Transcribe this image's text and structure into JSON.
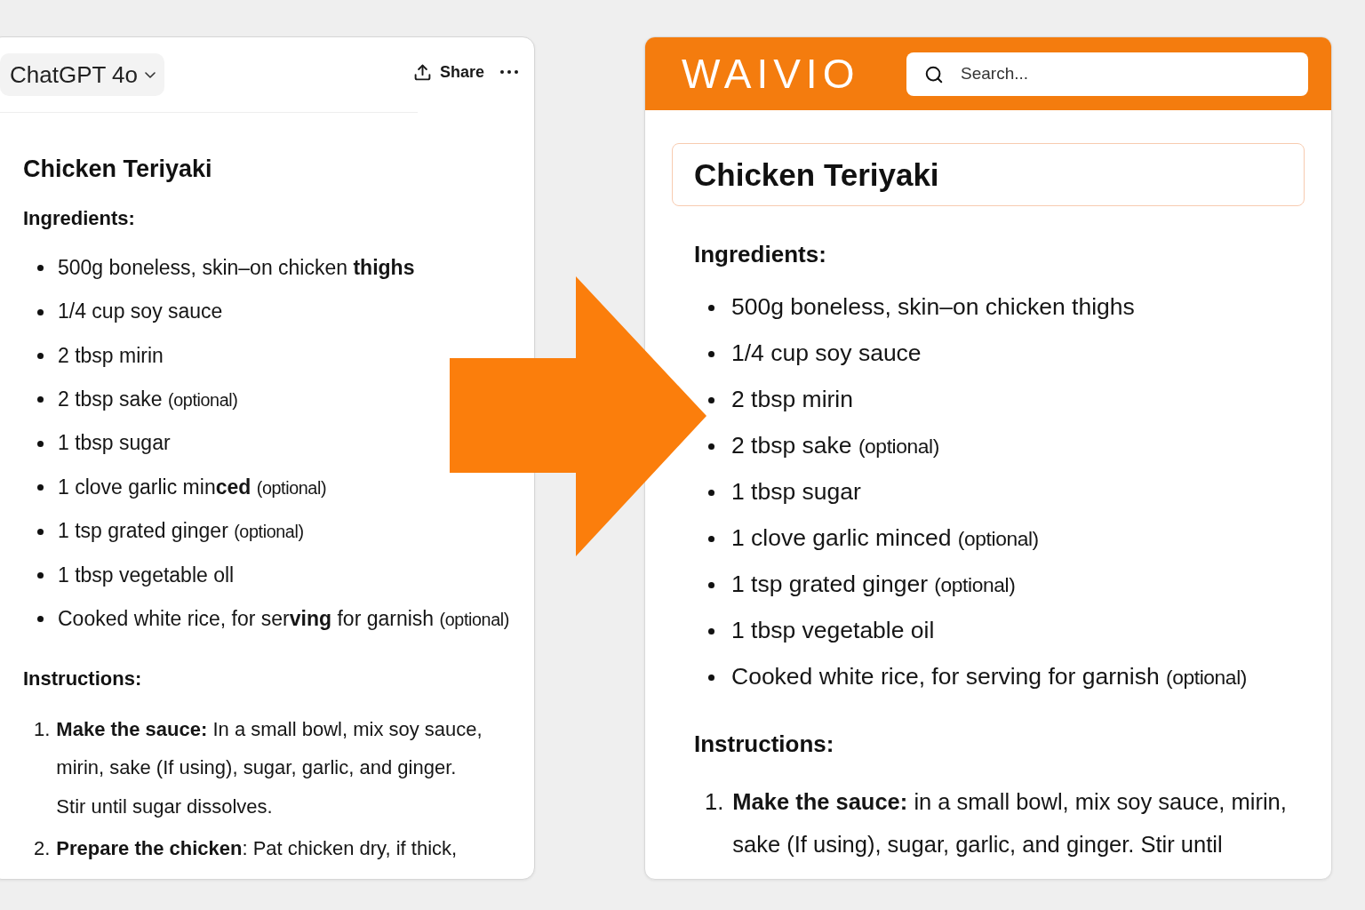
{
  "left_panel": {
    "model_selector": {
      "label": "ChatGPT 4o"
    },
    "share_button": {
      "label": "Share"
    },
    "title": "Chicken Teriyaki",
    "ingredients_heading": "Ingredients:",
    "ingredients": [
      {
        "text": "500g boneless, skin–on chicken **thighs**"
      },
      {
        "text": "1/4 cup soy sauce"
      },
      {
        "text": "2 tbsp mirin"
      },
      {
        "text": "2 tbsp sake",
        "note": "(optional)"
      },
      {
        "text": "1 tbsp sugar"
      },
      {
        "text": "1 clove garlic min**ced**",
        "note": "(optional)"
      },
      {
        "text": "1 tsp grated ginger",
        "note": "(optional)"
      },
      {
        "text": "1 tbsp vegetable oll"
      },
      {
        "text": "Cooked white rice, for ser**ving** for garnish",
        "note": "(optional)"
      }
    ],
    "instructions_heading": "Instructions:",
    "instructions": [
      {
        "number": "1.",
        "text": "**Make the sauce:** In a small bowl, mix soy sauce, mirin, sake (If using), sugar, garlic, and ginger. Stir until sugar dissolves."
      },
      {
        "number": "2.",
        "text": "**Prepare the chicken**: Pat chicken dry, if thick,"
      }
    ]
  },
  "right_panel": {
    "logo": "WAIVIO",
    "search": {
      "placeholder": "Search..."
    },
    "title": "Chicken Teriyaki",
    "ingredients_heading": "Ingredients:",
    "ingredients": [
      {
        "text": "500g boneless, skin–on chicken thighs"
      },
      {
        "text": "1/4 cup soy sauce"
      },
      {
        "text": "2 tbsp mirin"
      },
      {
        "text": "2 tbsp sake",
        "note": "(optional)"
      },
      {
        "text": "1 tbsp sugar"
      },
      {
        "text": "1 clove garlic minced",
        "note": "(optional)"
      },
      {
        "text": "1 tsp grated ginger",
        "note": "(optional)"
      },
      {
        "text": "1 tbsp vegetable oil"
      },
      {
        "text": "Cooked white rice, for serving for garnish",
        "note": "(optional)"
      }
    ],
    "instructions_heading": "Instructions:",
    "instructions": [
      {
        "number": "1.",
        "text": "**Make the sauce:** in a small bowl, mix soy sauce, mirin, sake (If using), sugar, garlic, and ginger. Stir until"
      }
    ]
  }
}
